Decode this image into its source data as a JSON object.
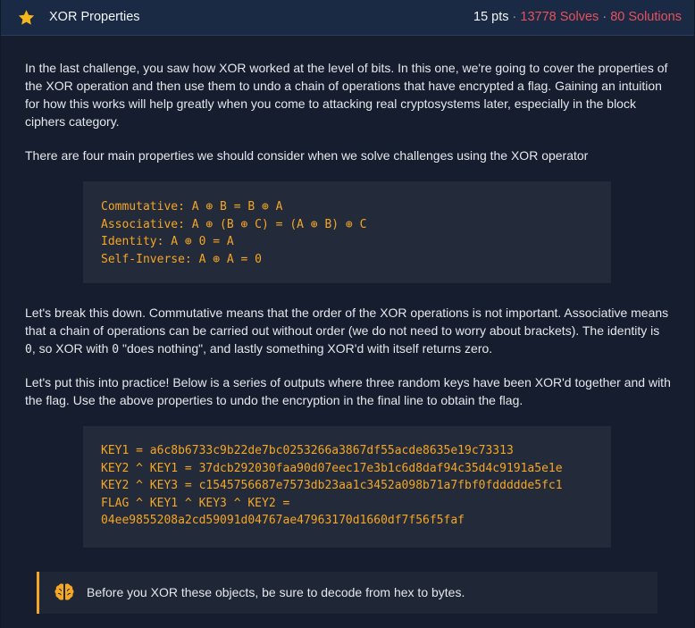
{
  "header": {
    "title": "XOR Properties",
    "points": "15 pts",
    "separator": "·",
    "solves": "13778 Solves",
    "solutions": "80 Solutions",
    "star_color": "#f5b81b"
  },
  "content": {
    "intro": "In the last challenge, you saw how XOR worked at the level of bits. In this one, we're going to cover the properties of the XOR operation and then use them to undo a chain of operations that have encrypted a flag. Gaining an intuition for how this works will help greatly when you come to attacking real cryptosystems later, especially in the block ciphers category.",
    "properties_lead": "There are four main properties we should consider when we solve challenges using the XOR operator",
    "properties_code": [
      "Commutative: A ⊕ B = B ⊕ A",
      "Associative: A ⊕ (B ⊕ C) = (A ⊕ B) ⊕ C",
      "Identity: A ⊕ 0 = A",
      "Self-Inverse: A ⊕ A = 0"
    ],
    "breakdown_1": "Let's break this down. Commutative means that the order of the XOR operations is not important. Associative means that a chain of operations can be carried out without order (we do not need to worry about brackets). The identity is ",
    "breakdown_zero_a": "0",
    "breakdown_2": ", so XOR with ",
    "breakdown_zero_b": "0",
    "breakdown_3": " \"does nothing\", and lastly something XOR'd with itself returns zero.",
    "practice": "Let's put this into practice! Below is a series of outputs where three random keys have been XOR'd together and with the flag. Use the above properties to undo the encryption in the final line to obtain the flag.",
    "keys_code": [
      "KEY1 = a6c8b6733c9b22de7bc0253266a3867df55acde8635e19c73313",
      "KEY2 ^ KEY1 = 37dcb292030faa90d07eec17e3b1c6d8daf94c35d4c9191a5e1e",
      "KEY2 ^ KEY3 = c1545756687e7573db23aa1c3452a098b71a7fbf0fddddde5fc1",
      "FLAG ^ KEY1 ^ KEY3 ^ KEY2 =",
      "04ee9855208a2cd59091d04767ae47963170d1660df7f56f5faf"
    ]
  },
  "hint": {
    "text": "Before you XOR these objects, be sure to decode from hex to bytes.",
    "accent": "#f5a623"
  },
  "colors": {
    "code_text": "#f5a623",
    "solves_red": "#e8515b",
    "header_bg": "#1a2a45",
    "panel_bg": "#161d2e"
  }
}
